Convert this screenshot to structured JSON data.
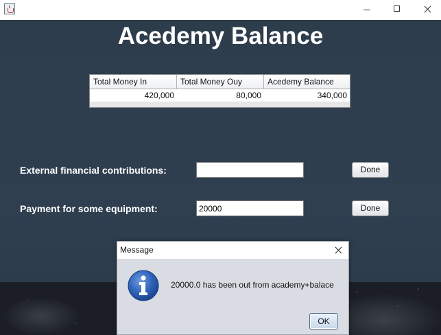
{
  "window": {
    "title": "",
    "icon": "java-cup-icon"
  },
  "page": {
    "title": "Acedemy Balance"
  },
  "table": {
    "columns": [
      "Total Money In",
      "Total Money Ouy",
      "Acedemy Balance"
    ],
    "rows": [
      [
        "420,000",
        "80,000",
        "340,000"
      ]
    ]
  },
  "form": {
    "external_label": "External financial contributions:",
    "external_value": "",
    "external_button": "Done",
    "payment_label": "Payment for some equipment:",
    "payment_value": "20000",
    "payment_button": "Done"
  },
  "dialog": {
    "title": "Message",
    "message": "20000.0 has been out from academy+balace",
    "ok_label": "OK",
    "icon": "info-icon"
  },
  "colors": {
    "background": "#2f3e4e",
    "title_text": "#ffffff",
    "info_blue": "#2f63b8"
  }
}
